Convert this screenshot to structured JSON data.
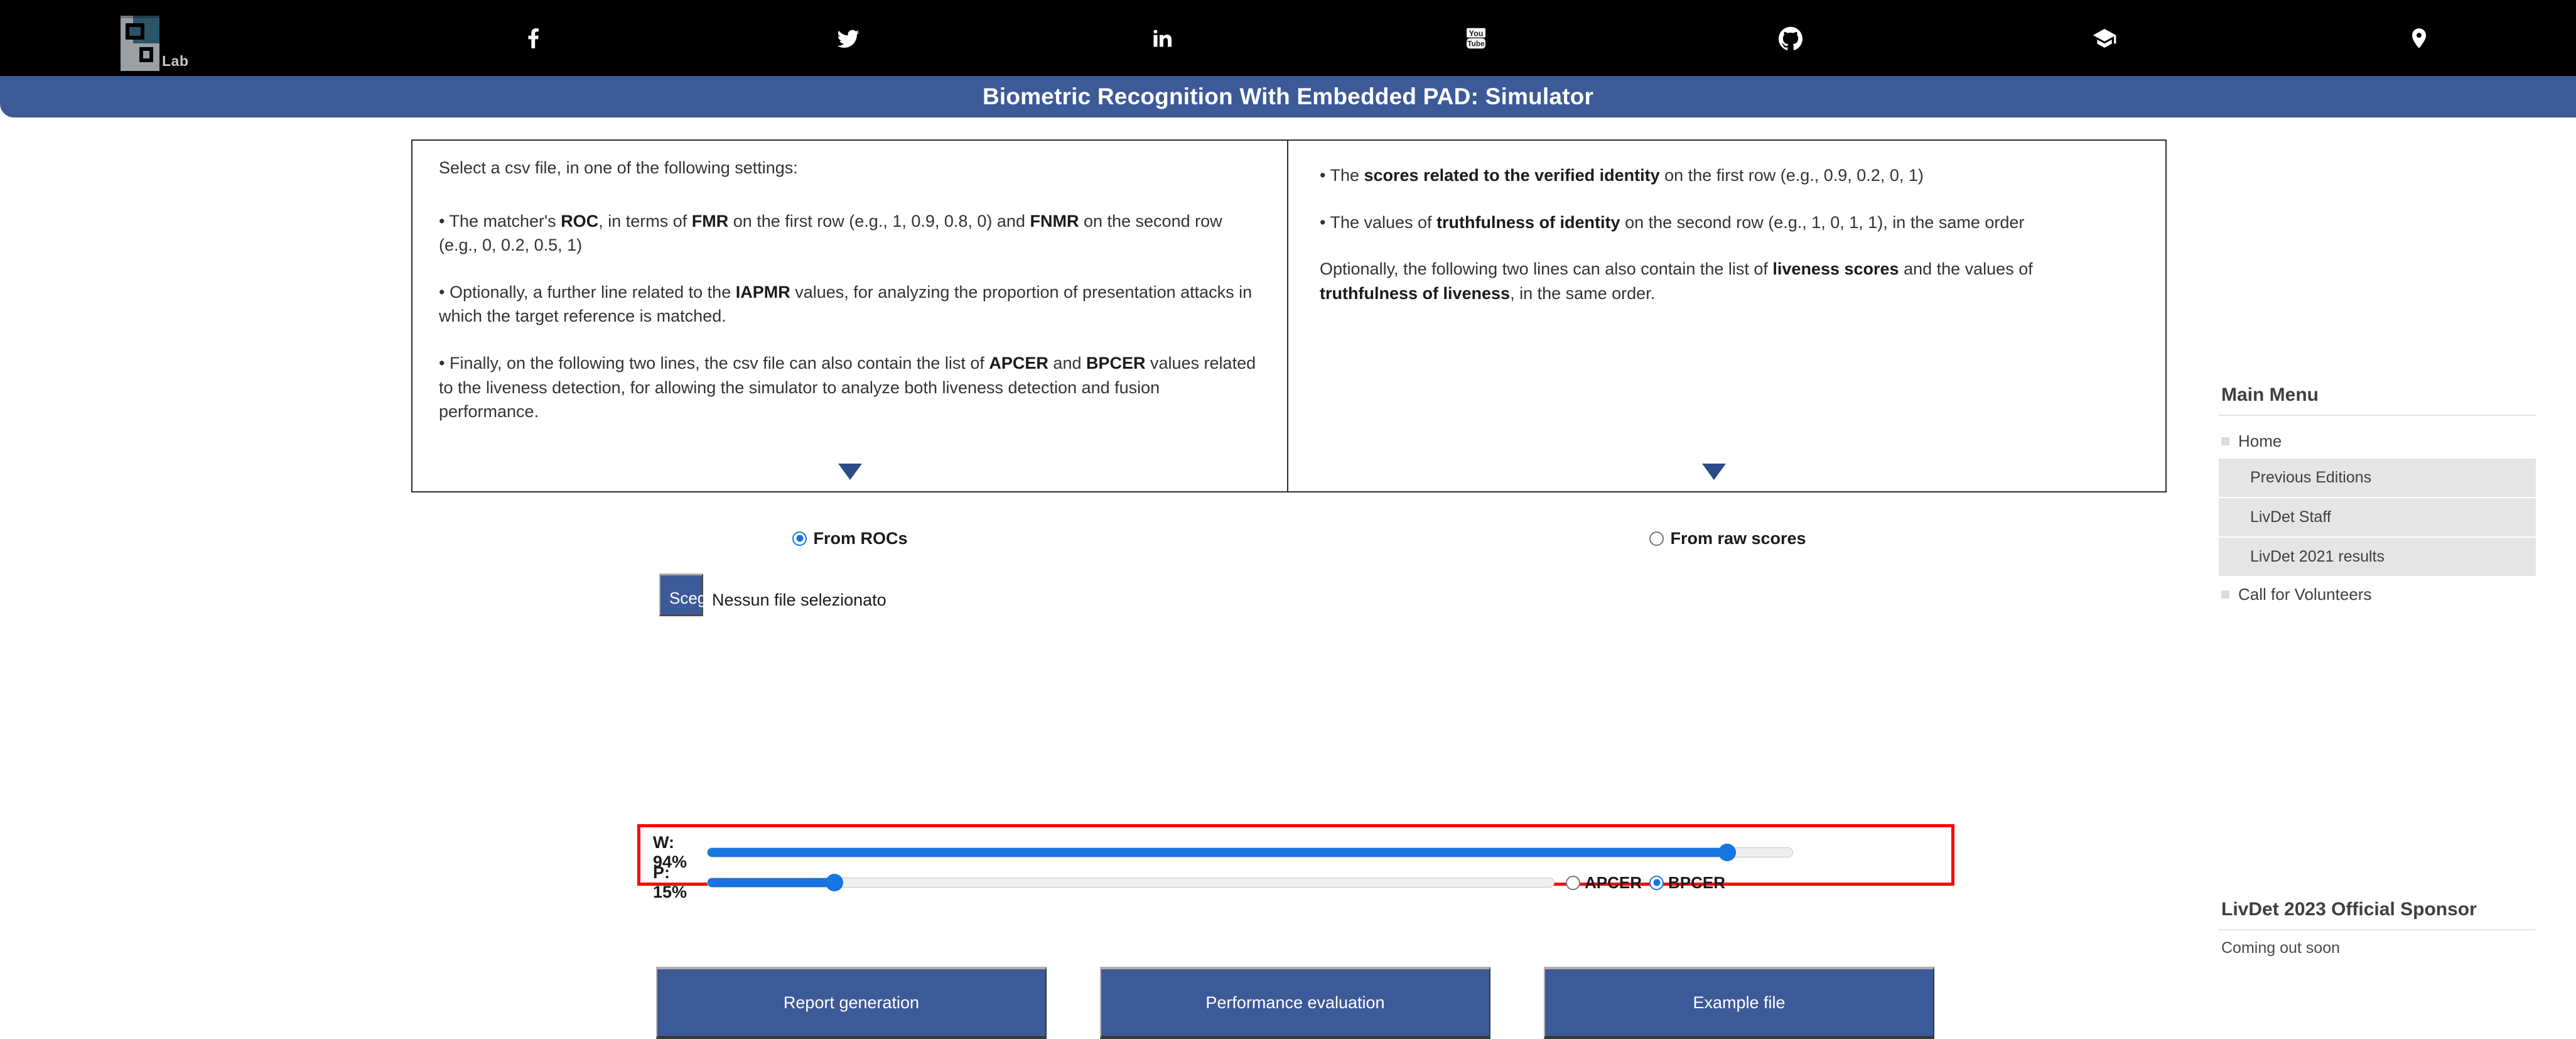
{
  "topbar": {
    "logo": {
      "name": "pralab-logo",
      "text": "Lab"
    },
    "social": [
      {
        "icon": "facebook-icon",
        "name": "facebook-link"
      },
      {
        "icon": "twitter-icon",
        "name": "twitter-link"
      },
      {
        "icon": "linkedin-icon",
        "name": "linkedin-link"
      },
      {
        "icon": "youtube-icon",
        "name": "youtube-link"
      },
      {
        "icon": "github-icon",
        "name": "github-link"
      },
      {
        "icon": "graduation-cap-icon",
        "name": "scholar-link"
      },
      {
        "icon": "location-pin-icon",
        "name": "location-link"
      }
    ]
  },
  "header": {
    "title": "Biometric Recognition With Embedded PAD: Simulator",
    "background_color": "#3d5a98"
  },
  "instructions": {
    "left": {
      "lead": "Select a csv file, in one of the following settings:",
      "items": [
        {
          "parts": [
            {
              "t": "• The matcher's ",
              "b": false
            },
            {
              "t": "ROC",
              "b": true
            },
            {
              "t": ", in terms of ",
              "b": false
            },
            {
              "t": "FMR",
              "b": true
            },
            {
              "t": " on the first row (e.g., 1, 0.9, 0.8, 0) and ",
              "b": false
            },
            {
              "t": "FNMR",
              "b": true
            },
            {
              "t": " on the second row (e.g., 0, 0.2, 0.5, 1)",
              "b": false
            }
          ]
        },
        {
          "parts": [
            {
              "t": "• Optionally, a further line related to the ",
              "b": false
            },
            {
              "t": "IAPMR",
              "b": true
            },
            {
              "t": " values, for analyzing the proportion of presentation attacks in which the target reference is matched.",
              "b": false
            }
          ]
        },
        {
          "parts": [
            {
              "t": "• Finally, on the following two lines, the csv file can also contain the list of ",
              "b": false
            },
            {
              "t": "APCER",
              "b": true
            },
            {
              "t": " and ",
              "b": false
            },
            {
              "t": "BPCER",
              "b": true
            },
            {
              "t": " values related to the liveness detection, for allowing the simulator to analyze both liveness detection and fusion performance.",
              "b": false
            }
          ]
        }
      ],
      "arrow": "chevron-down-icon"
    },
    "right": {
      "items": [
        {
          "parts": [
            {
              "t": "• The ",
              "b": false
            },
            {
              "t": "scores related to the verified identity",
              "b": true
            },
            {
              "t": " on the first row (e.g., 0.9, 0.2, 0, 1)",
              "b": false
            }
          ]
        },
        {
          "parts": [
            {
              "t": "• The values of ",
              "b": false
            },
            {
              "t": "truthfulness of identity",
              "b": true
            },
            {
              "t": " on the second row (e.g., 1, 0, 1, 1), in the same order",
              "b": false
            }
          ]
        },
        {
          "parts": [
            {
              "t": "Optionally, the following two lines can also contain the list of ",
              "b": false
            },
            {
              "t": "liveness scores",
              "b": true
            },
            {
              "t": " and the values of ",
              "b": false
            },
            {
              "t": "truthfulness of liveness",
              "b": true
            },
            {
              "t": ", in the same order.",
              "b": false
            }
          ]
        }
      ],
      "arrow": "chevron-down-icon"
    }
  },
  "source_mode": {
    "options": [
      {
        "label": "From ROCs",
        "checked": true
      },
      {
        "label": "From raw scores",
        "checked": false
      }
    ]
  },
  "file_input": {
    "button_label": "Scegli file",
    "file_name": "Nessun file selezionato"
  },
  "sliders": {
    "border_color": "#ff0000",
    "rows": [
      {
        "label": "W: 94%",
        "value": 94,
        "name": "w-slider"
      },
      {
        "label": "P: 15%",
        "value": 15,
        "name": "p-slider"
      }
    ],
    "metric_options": [
      {
        "label": "APCER",
        "checked": false
      },
      {
        "label": "BPCER",
        "checked": true
      }
    ],
    "fill_color": "#1675e0"
  },
  "actions": [
    {
      "label": "Report generation",
      "name": "report-generation-button"
    },
    {
      "label": "Performance evaluation",
      "name": "performance-evaluation-button"
    },
    {
      "label": "Example file",
      "name": "example-file-button"
    }
  ],
  "sidebar": {
    "main_menu_title": "Main Menu",
    "home": "Home",
    "sub_items": [
      "Previous Editions",
      "LivDet Staff",
      "LivDet 2021 results"
    ],
    "call_for_volunteers": "Call for Volunteers",
    "sponsor_title": "LivDet 2023 Official Sponsor",
    "sponsor_text": "Coming out soon"
  }
}
